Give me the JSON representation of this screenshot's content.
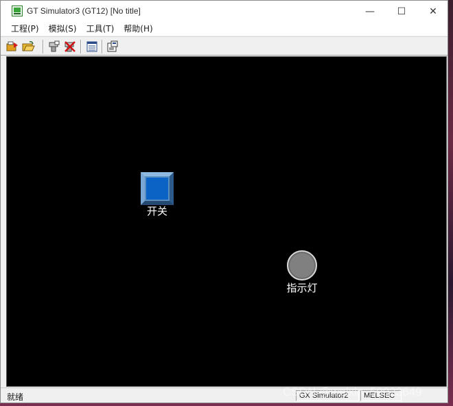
{
  "window": {
    "title": "GT Simulator3 (GT12)  [No title]",
    "app_icon": "gt-simulator-icon",
    "controls": {
      "minimize": "—",
      "maximize": "☐",
      "close": "✕"
    }
  },
  "menu": [
    "工程(P)",
    "模拟(S)",
    "工具(T)",
    "帮助(H)"
  ],
  "toolbar": {
    "buttons": [
      {
        "icon": "open-project-icon"
      },
      {
        "icon": "open-folder-icon"
      },
      {
        "icon": "device-monitor-icon"
      },
      {
        "icon": "device-stop-icon"
      },
      {
        "icon": "list-view-icon"
      },
      {
        "icon": "properties-icon"
      }
    ]
  },
  "canvas": {
    "background": "#000000",
    "switch": {
      "label": "开关",
      "color": "#0a63c5"
    },
    "lamp": {
      "label": "指示灯",
      "color": "#808080"
    }
  },
  "status": {
    "left": "就绪",
    "pane1": "GX Simulator2",
    "pane2": "MELSEC"
  },
  "watermark": "CSDN @weixin_59923649"
}
